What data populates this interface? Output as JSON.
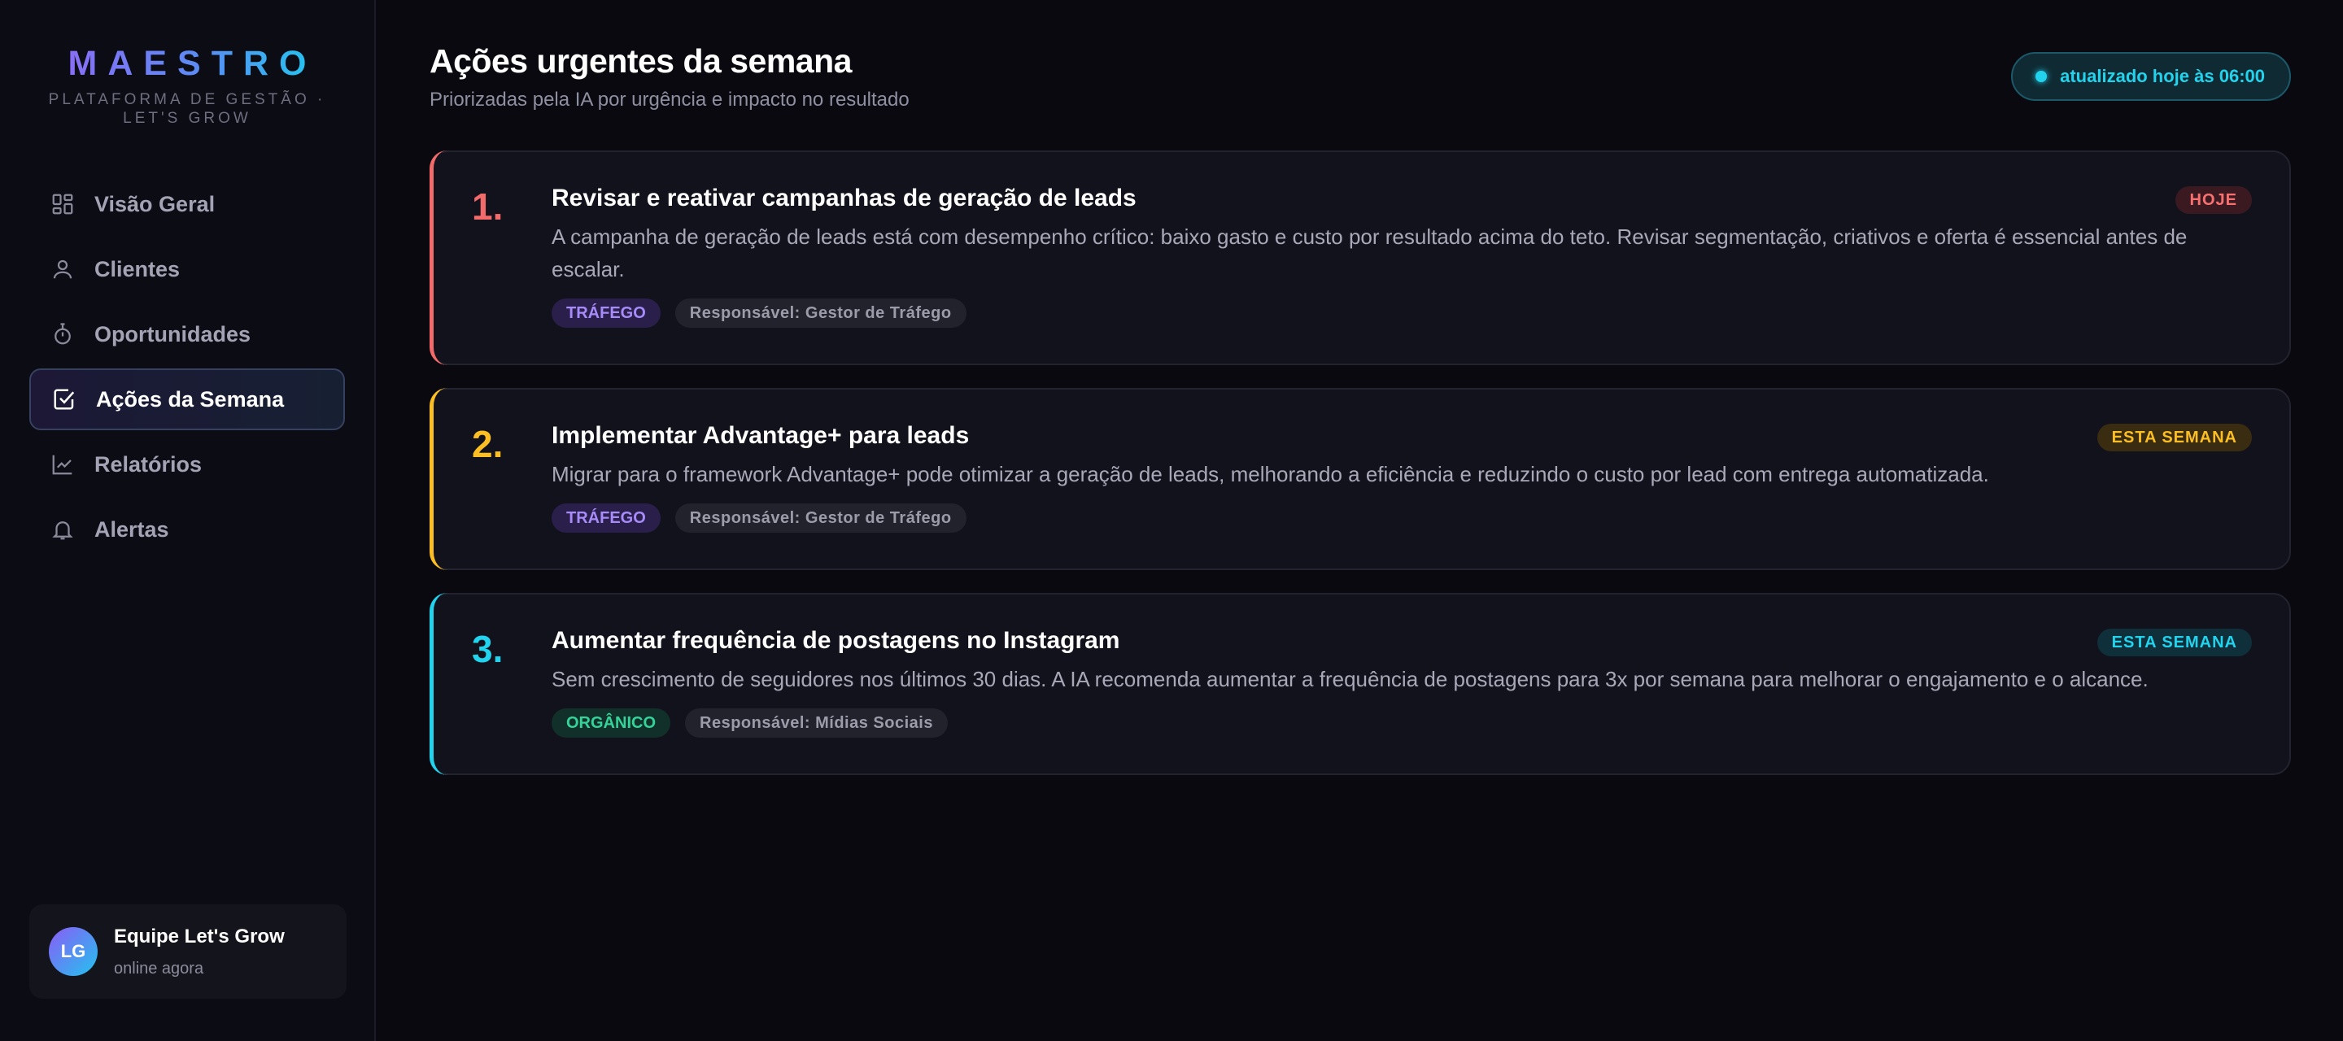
{
  "brand": {
    "logo": "MAESTRO",
    "subtitle": "PLATAFORMA DE GESTÃO · LET'S GROW"
  },
  "sidebar": {
    "items": [
      {
        "label": "Visão Geral",
        "icon": "grid-icon",
        "active": false
      },
      {
        "label": "Clientes",
        "icon": "user-icon",
        "active": false
      },
      {
        "label": "Oportunidades",
        "icon": "timer-icon",
        "active": false
      },
      {
        "label": "Ações da Semana",
        "icon": "checkbox-icon",
        "active": true
      },
      {
        "label": "Relatórios",
        "icon": "line-chart-icon",
        "active": false
      },
      {
        "label": "Alertas",
        "icon": "bell-icon",
        "active": false
      }
    ],
    "user": {
      "initials": "LG",
      "name": "Equipe Let's Grow",
      "status": "online agora"
    }
  },
  "header": {
    "title": "Ações urgentes da semana",
    "subtitle": "Priorizadas pela IA por urgência e impacto no resultado",
    "updated": "atualizado hoje às 06:00"
  },
  "actions": [
    {
      "number": "1.",
      "title": "Revisar e reativar campanhas de geração de leads",
      "description": "A campanha de geração de leads está com desempenho crítico: baixo gasto e custo por resultado acima do teto. Revisar segmentação, criativos e oferta é essencial antes de escalar.",
      "category": "TRÁFEGO",
      "owner": "Responsável: Gestor de Tráfego",
      "urgency": "HOJE",
      "accent": "#f26a6a"
    },
    {
      "number": "2.",
      "title": "Implementar Advantage+ para leads",
      "description": "Migrar para o framework Advantage+ pode otimizar a geração de leads, melhorando a eficiência e reduzindo o custo por lead com entrega automatizada.",
      "category": "TRÁFEGO",
      "owner": "Responsável: Gestor de Tráfego",
      "urgency": "ESTA SEMANA",
      "accent": "#fbbf24"
    },
    {
      "number": "3.",
      "title": "Aumentar frequência de postagens no Instagram",
      "description": "Sem crescimento de seguidores nos últimos 30 dias. A IA recomenda aumentar a frequência de postagens para 3x por semana para melhorar o engajamento e o alcance.",
      "category": "ORGÂNICO",
      "owner": "Responsável: Mídias Sociais",
      "urgency": "ESTA SEMANA",
      "accent": "#22d3ee"
    }
  ],
  "colors": {
    "tag_trafego_bg": "#2a1f4a",
    "tag_trafego_fg": "#a78bfa",
    "tag_organico_bg": "#12302a",
    "tag_organico_fg": "#34d399",
    "urgency_hoje_bg": "#3a1a20",
    "urgency_hoje_fg": "#f87171",
    "urgency_semana_amber_bg": "#3a2c10",
    "urgency_semana_amber_fg": "#fbbf24",
    "urgency_semana_cyan_bg": "#0f2f3a",
    "urgency_semana_cyan_fg": "#22d3ee"
  }
}
